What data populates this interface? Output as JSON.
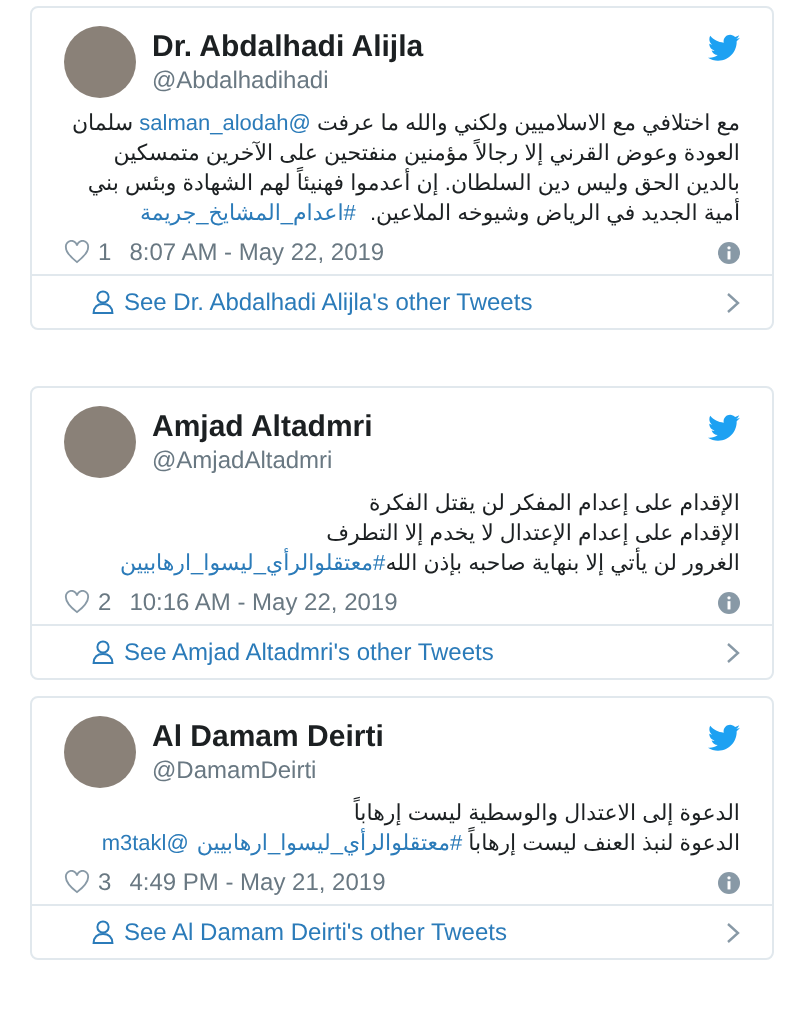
{
  "tweets": [
    {
      "name": "Dr. Abdalhadi Alijla",
      "handle": "@Abdalhadihadi",
      "lines": [
        [
          {
            "kind": "text",
            "text": "مع اختلافي مع الاسلاميين ولكني والله ما عرفت "
          },
          {
            "kind": "link",
            "text": "@salman_alodah"
          },
          {
            "kind": "text",
            "text": " سلمان العودة وعوض القرني إلا رجالاً مؤمنين منفتحين على الآخرين متمسكين بالدين الحق وليس دين السلطان. إن أعدموا فهنيئاً لهم الشهادة وبئس بني أمية الجديد في الرياض وشيوخه الملاعين. "
          },
          {
            "kind": "link",
            "text": "#اعدام_المشايخ_جريمة"
          }
        ]
      ],
      "likes": "1",
      "time": "8:07 AM - May 22, 2019",
      "footer": "See Dr. Abdalhadi Alijla's other Tweets"
    },
    {
      "name": "Amjad Altadmri",
      "handle": "@AmjadAltadmri",
      "lines": [
        [
          {
            "kind": "text",
            "text": "الإقدام على إعدام المفكر لن يقتل الفكرة"
          }
        ],
        [
          {
            "kind": "text",
            "text": "الإقدام على إعدام الإعتدال لا يخدم إلا التطرف"
          }
        ],
        [
          {
            "kind": "text",
            "text": "الغرور لن يأتي إلا بنهاية صاحبه بإذن الله"
          },
          {
            "kind": "link",
            "text": "#معتقلوالرأي_ليسوا_ارهابيين"
          }
        ]
      ],
      "likes": "2",
      "time": "10:16 AM - May 22, 2019",
      "footer": "See Amjad Altadmri's other Tweets"
    },
    {
      "name": "Al Damam Deirti",
      "handle": "@DamamDeirti",
      "lines": [
        [
          {
            "kind": "text",
            "text": "الدعوة إلى الاعتدال والوسطية ليست إرهاباً"
          }
        ],
        [
          {
            "kind": "text",
            "text": "الدعوة لنبذ العنف ليست إرهاباً "
          },
          {
            "kind": "link",
            "text": "#معتقلوالرأي_ليسوا_ارهابيين"
          },
          {
            "kind": "link",
            "text": "@m3takl"
          }
        ]
      ],
      "likes": "3",
      "time": "4:49 PM - May 21, 2019",
      "footer": "See Al Damam Deirti's other Tweets"
    }
  ]
}
